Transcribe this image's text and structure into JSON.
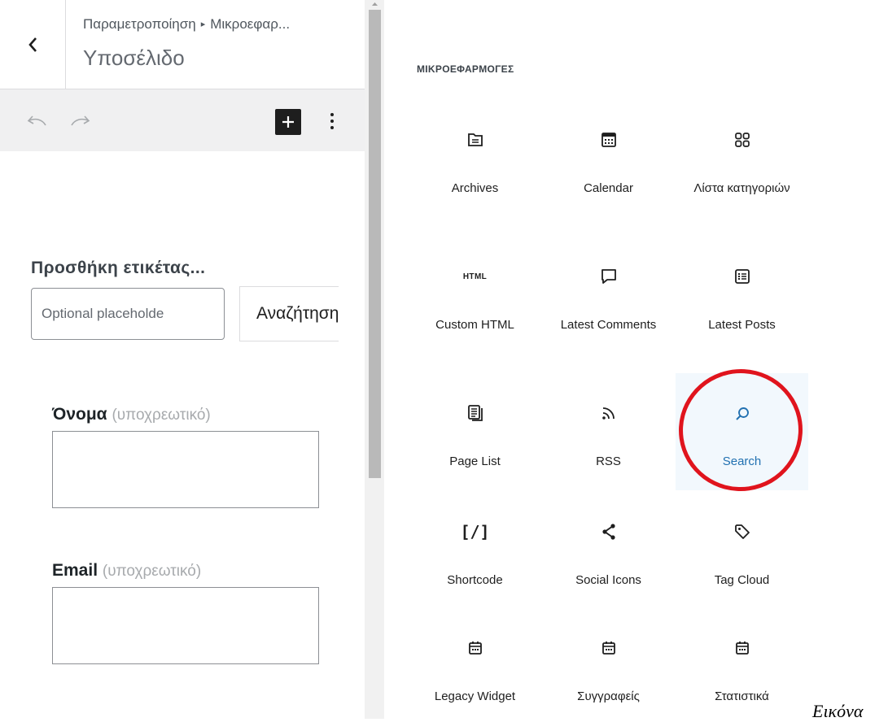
{
  "header": {
    "breadcrumb_parent": "Παραμετροποίηση",
    "breadcrumb_separator": "▸",
    "breadcrumb_current": "Μικροεφαρ...",
    "title": "Υποσέλιδο"
  },
  "toolbar": {
    "undo_icon": "undo-icon",
    "redo_icon": "redo-icon",
    "inserter_icon": "plus-icon",
    "options_icon": "more-vertical-icon"
  },
  "search_block": {
    "label": "Προσθήκη ετικέτας...",
    "input_placeholder": "Optional placeholde",
    "button_label": "Αναζήτηση"
  },
  "form": {
    "name_label": "Όνομα",
    "name_required": "(υποχρεωτικό)",
    "email_label": "Email",
    "email_required": "(υποχρεωτικό)"
  },
  "inserter": {
    "category_title": "ΜΙΚΡΟΕΦΑΡΜΟΓΕΣ",
    "highlight_color": "#e0141d",
    "selected_color": "#2271b1",
    "items": [
      {
        "label": "Archives",
        "icon": "archive-icon"
      },
      {
        "label": "Calendar",
        "icon": "calendar-icon"
      },
      {
        "label": "Λίστα κατηγοριών",
        "icon": "categories-icon"
      },
      {
        "label": "Custom HTML",
        "icon": "html-icon",
        "icon_text": "HTML"
      },
      {
        "label": "Latest Comments",
        "icon": "comment-icon"
      },
      {
        "label": "Latest Posts",
        "icon": "post-list-icon"
      },
      {
        "label": "Page List",
        "icon": "pages-icon"
      },
      {
        "label": "RSS",
        "icon": "rss-icon"
      },
      {
        "label": "Search",
        "icon": "search-icon",
        "selected": true
      },
      {
        "label": "Shortcode",
        "icon": "shortcode-icon",
        "icon_text": "[/]"
      },
      {
        "label": "Social Icons",
        "icon": "share-icon"
      },
      {
        "label": "Tag Cloud",
        "icon": "tag-icon"
      },
      {
        "label": "Legacy Widget",
        "icon": "widget-calendar-icon"
      },
      {
        "label": "Συγγραφείς",
        "icon": "widget-calendar-icon"
      },
      {
        "label": "Στατιστικά",
        "icon": "widget-calendar-icon"
      }
    ]
  },
  "caption": "Εικόνα"
}
